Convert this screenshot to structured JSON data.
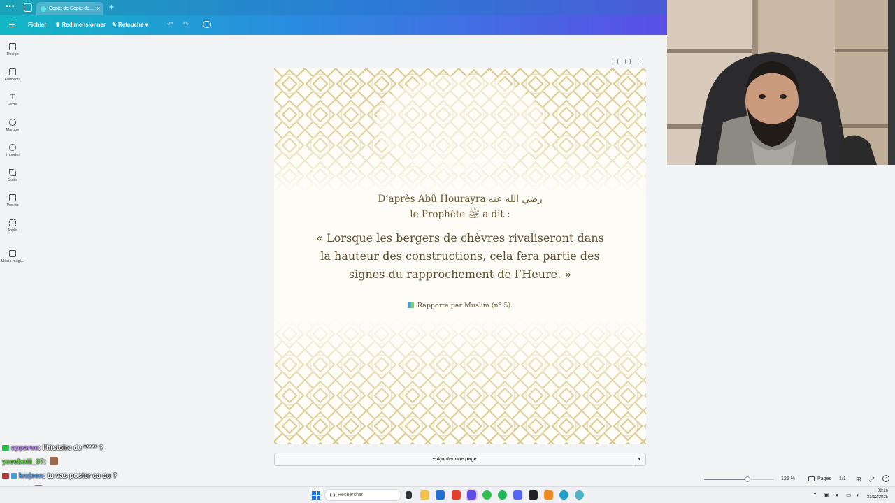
{
  "browser": {
    "tab_title": "Copie de Copie de...",
    "tab_close": "×",
    "new_tab": "+"
  },
  "toolbar": {
    "file": "Fichier",
    "resize": "Redimensionner",
    "retouch": "Retouche",
    "undo": "↶",
    "redo": "↷"
  },
  "sidebar": {
    "items": [
      {
        "label": "Design",
        "icon": "layout-icon"
      },
      {
        "label": "Éléments",
        "icon": "shapes-icon"
      },
      {
        "label": "Texte",
        "icon": "text-icon"
      },
      {
        "label": "Marque",
        "icon": "brand-icon"
      },
      {
        "label": "Importer",
        "icon": "upload-icon"
      },
      {
        "label": "Outils",
        "icon": "pen-icon"
      },
      {
        "label": "Projets",
        "icon": "folder-icon"
      },
      {
        "label": "Applis",
        "icon": "apps-icon"
      },
      {
        "label": "Média magi...",
        "icon": "magic-media-icon"
      }
    ]
  },
  "design": {
    "narration_line1": "D’après Abû Hourayra رضي الله عنه",
    "narration_line2": "le Prophète ﷺ a dit :",
    "quote": "« Lorsque les bergers de chèvres rivaliseront dans la hauteur des constructions, cela fera partie des signes du rapprochement de l’Heure. »",
    "source": "Rapporté par Muslim (n° 5).",
    "pattern_color": "#d9c98f",
    "text_color": "#6b5a32"
  },
  "add_page": "+ Ajouter une page",
  "footer": {
    "zoom_label": "125 %",
    "zoom_fraction": 0.62,
    "pages_label": "Pages",
    "page_count": "1/1"
  },
  "chat": [
    {
      "user": "apparue",
      "user_color": "#c48cff",
      "badge_color": "#2fbf4a",
      "message": "l'histoire de ***** ?"
    },
    {
      "user": "yeeeboiii_07",
      "user_color": "#5ddc3a",
      "badge_color": "",
      "message": ""
    },
    {
      "user": "kmjeen",
      "user_color": "#5aa8ff",
      "badge_color": "#b33a3a",
      "message": "tu vas poster ca ou ?"
    },
    {
      "user": "zarrassi",
      "user_color": "#ffffff",
      "badge_color": "#b33a3a",
      "message": ""
    }
  ],
  "taskbar": {
    "search_placeholder": "Rechercher",
    "time": "08:26",
    "date": "31/12/2025"
  }
}
